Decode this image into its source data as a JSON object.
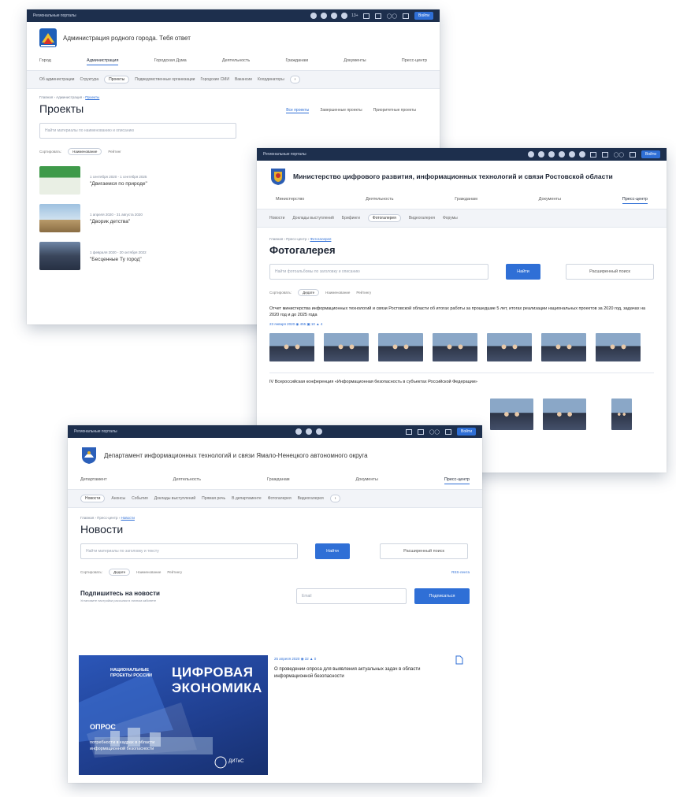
{
  "card1": {
    "topbar_label": "Региональные порталы",
    "topbar_counter": "13+",
    "login": "Войти",
    "org_name": "Администрация родного города. Тебя ответ",
    "menu": [
      "Город",
      "Администрация",
      "Городская Дума",
      "Деятельность",
      "Гражданам",
      "Документы",
      "Пресс-центр"
    ],
    "submenu": [
      "Об администрации",
      "Структура",
      "Проекты",
      "Подведомственные организации",
      "Городские СМИ",
      "Вакансии",
      "Координаторы"
    ],
    "crumb": [
      "Главная",
      "Администрация",
      "Проекты"
    ],
    "title": "Проекты",
    "tabs": [
      "Все проекты",
      "Завершенные проекты",
      "Приоритетные проекты"
    ],
    "search_placeholder": "Найти материалы по наименованию и описанию",
    "sort_label": "Сортировать:",
    "sort_options": [
      "Наименование",
      "Рейтинг"
    ],
    "items": [
      {
        "date": "1 сентября 2020 - 1 сентября 2025",
        "title": "\"Двигаемся по природе\""
      },
      {
        "date": "1 апреля 2020 - 31 августа 2020",
        "title": "\"Дворик детства\""
      },
      {
        "date": "1 февраля 2020 - 20 октября 2022",
        "title": "\"Бесценные Ту город\""
      }
    ]
  },
  "card2": {
    "topbar_label": "Региональные порталы",
    "login": "Войти",
    "org_name": "Министерство цифрового развития, информационных технологий и связи Ростовской области",
    "menu": [
      "Министерство",
      "Деятельность",
      "Гражданам",
      "Документы",
      "Пресс-центр"
    ],
    "submenu": [
      "Новости",
      "Доклады выступлений",
      "Брифинги",
      "Фотогалерея",
      "Видеогалерея",
      "Форумы"
    ],
    "crumb": [
      "Главная",
      "Пресс-центр",
      "Фотогалерея"
    ],
    "title": "Фотогалерея",
    "search_placeholder": "Найти фотоальбомы по заголовку и описанию",
    "find": "Найти",
    "advanced": "Расширенный поиск",
    "sort_label": "Сортировать:",
    "sort_options": [
      "Дедате",
      "Наименование",
      "Рейтингу"
    ],
    "album_title": "Отчет министерства информационных технологий и связи Ростовской области об итогах работы за прошедшие 5 лет, итогах реализации национальных проектов за 2020 год, задачах на 2020 год и до 2025 года",
    "album_meta": "23 января 2020   ◉ 455   ▣ 10   ▲ 4",
    "album2_title": "IV Всероссийская конференция «Информационная безопасность в субъектах Российской Федерации»"
  },
  "card3": {
    "topbar_label": "Региональные порталы",
    "login": "Войти",
    "org_name": "Департамент информационных технологий и связи Ямало-Ненецкого автономного округа",
    "menu": [
      "Департамент",
      "Деятельность",
      "Гражданам",
      "Документы",
      "Пресс-центр"
    ],
    "submenu": [
      "Новости",
      "Анонсы",
      "События",
      "Доклады выступлений",
      "Прямая речь",
      "В департаменте",
      "Фотогалерея",
      "Видеогалерея"
    ],
    "crumb": [
      "Главная",
      "Пресс-центр",
      "Новости"
    ],
    "title": "Новости",
    "search_placeholder": "Найти материалы по заголовку и тексту",
    "find": "Найти",
    "advanced": "Расширенный поиск",
    "sort_label": "Сортировать:",
    "sort_options": [
      "Дедате",
      "Наименование",
      "Рейтингу"
    ],
    "rss": "RSS-лента",
    "subscribe_title": "Подпишитесь на новости",
    "subscribe_sub": "Установите настройки рассылки в личном кабинете",
    "email_placeholder": "Email",
    "subscribe_btn": "Подписаться",
    "news_meta": "25 апреля 2020   ◉ 32   ▲ 0",
    "news_title": "О проведении опроса для выявления актуальных задач в области информационной безопасности",
    "banner_left": "НАЦИОНАЛЬНЫЕ ПРОЕКТЫ РОССИИ",
    "banner_big1": "ЦИФРОВАЯ",
    "banner_big2": "ЭКОНОМИКА",
    "banner_poll": "ОПРОС",
    "banner_text": "потребности в кадрах в области информационной безопасности",
    "banner_logo": "ДИТиС"
  }
}
